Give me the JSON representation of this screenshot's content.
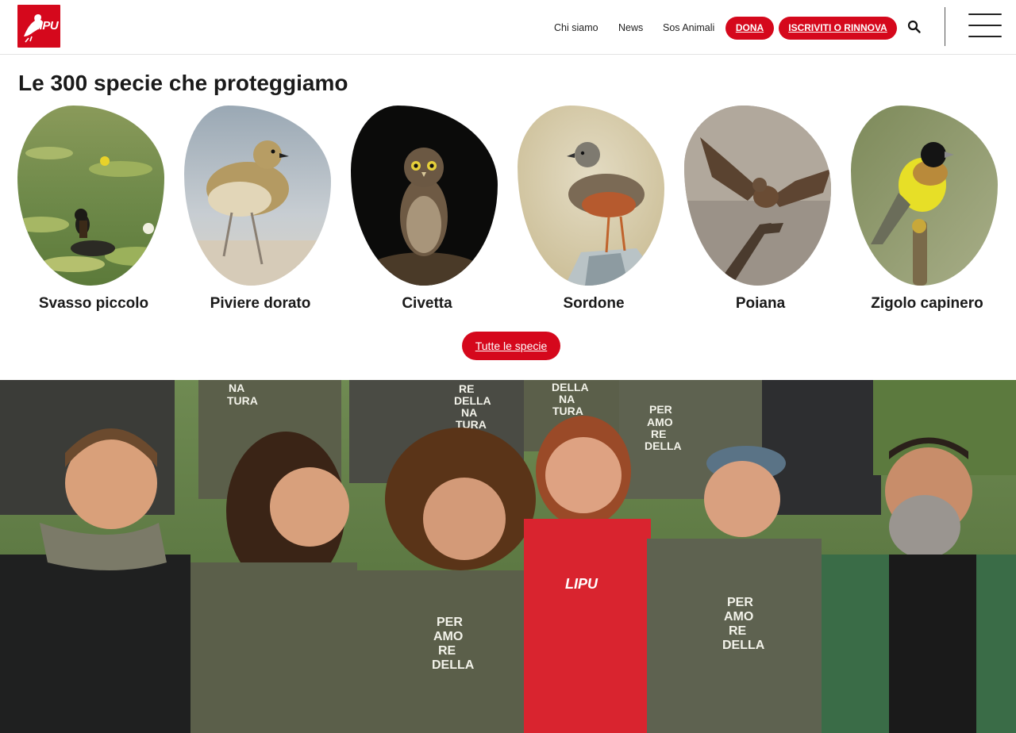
{
  "header": {
    "logo": {
      "text": "LIPU",
      "icon": "lipu-bird-logo",
      "color": "#d5081c"
    },
    "nav": {
      "chi_siamo": "Chi siamo",
      "news": "News",
      "sos_animali": "Sos Animali"
    },
    "buttons": {
      "dona": "DONA",
      "iscriviti": "ISCRIVITI O RINNOVA"
    },
    "search_icon": "search-icon",
    "menu_icon": "hamburger-menu-icon"
  },
  "species_section": {
    "title": "Le 300 specie che proteggiamo",
    "items": [
      {
        "name": "Svasso piccolo",
        "photo": "little-grebe-on-lily-pond"
      },
      {
        "name": "Piviere dorato",
        "photo": "golden-plover-on-shore"
      },
      {
        "name": "Civetta",
        "photo": "little-owl-at-night"
      },
      {
        "name": "Sordone",
        "photo": "alpine-accentor-on-rock"
      },
      {
        "name": "Poiana",
        "photo": "buzzard-landing-on-branch"
      },
      {
        "name": "Zigolo capinero",
        "photo": "black-headed-bunting-on-perch"
      }
    ],
    "cta": "Tutte le specie"
  },
  "team_photo": {
    "subject": "group-of-volunteers-in-per-amore-della-natura-t-shirts",
    "shirt_text": [
      "PER",
      "AMO",
      "RE",
      "DELLA",
      "NA",
      "TURA"
    ],
    "badge_text": "LIPU"
  },
  "colors": {
    "brand_red": "#d5081c",
    "text": "#1a1a1a",
    "shirt_green": "#5b5f4a"
  }
}
